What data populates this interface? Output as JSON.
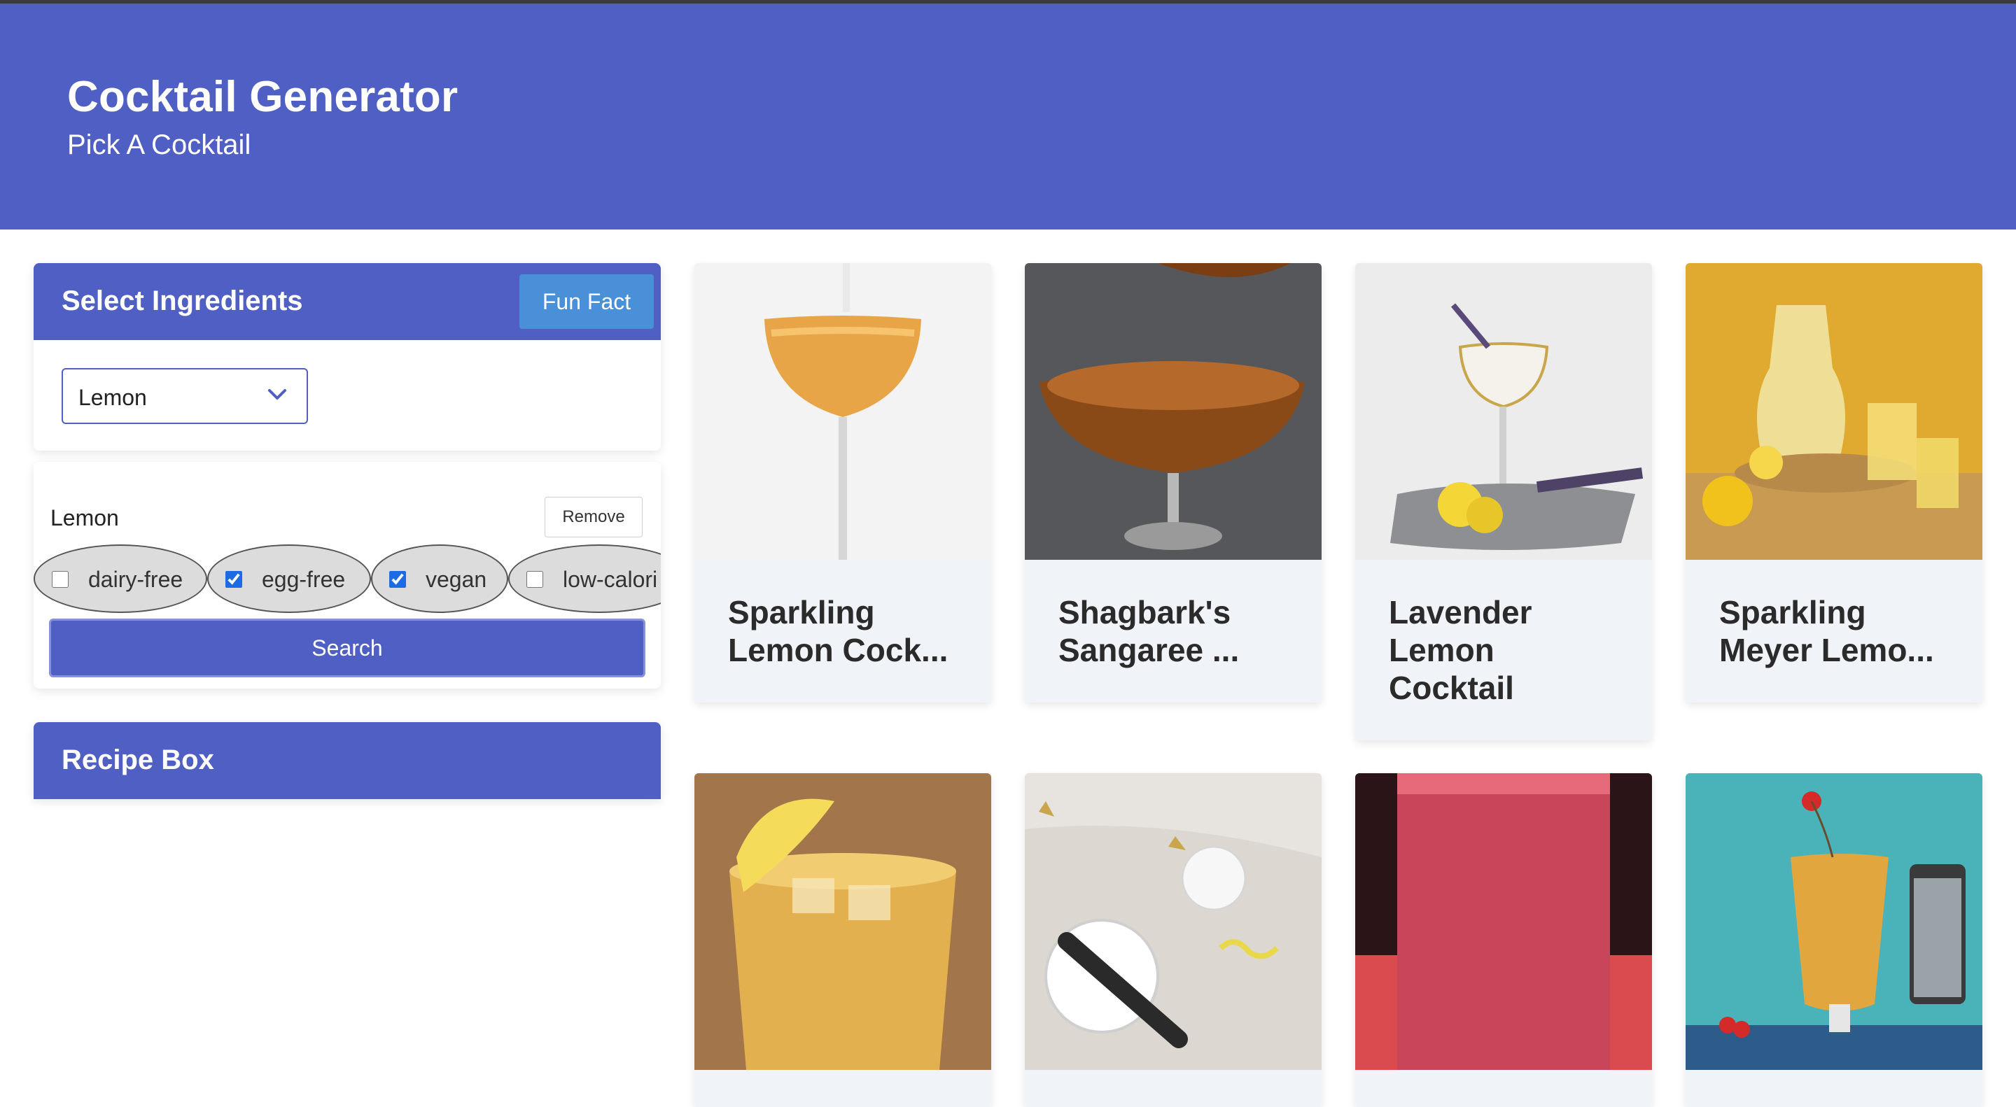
{
  "header": {
    "title": "Cocktail Generator",
    "subtitle": "Pick A Cocktail"
  },
  "ingredient_panel": {
    "title": "Select Ingredients",
    "fun_fact_label": "Fun Fact",
    "selected_value": "Lemon"
  },
  "filters": {
    "selected_ingredient": "Lemon",
    "remove_label": "Remove",
    "diets": [
      {
        "label": "dairy-free",
        "checked": false
      },
      {
        "label": "egg-free",
        "checked": true
      },
      {
        "label": "vegan",
        "checked": true
      },
      {
        "label": "low-calori",
        "checked": false
      }
    ],
    "search_label": "Search"
  },
  "recipe_box": {
    "title": "Recipe Box"
  },
  "cocktails": [
    {
      "name_line1": "Sparkling",
      "name_line2": "Lemon Cock...",
      "name_line3": ""
    },
    {
      "name_line1": "Shagbark's",
      "name_line2": "Sangaree ...",
      "name_line3": ""
    },
    {
      "name_line1": "Lavender",
      "name_line2": "Lemon",
      "name_line3": "Cocktail"
    },
    {
      "name_line1": "Sparkling",
      "name_line2": "Meyer Lemo...",
      "name_line3": ""
    }
  ],
  "colors": {
    "brand": "#4f5fc4",
    "fun_fact": "#4a90d9",
    "card_bg": "#f0f4f9"
  }
}
